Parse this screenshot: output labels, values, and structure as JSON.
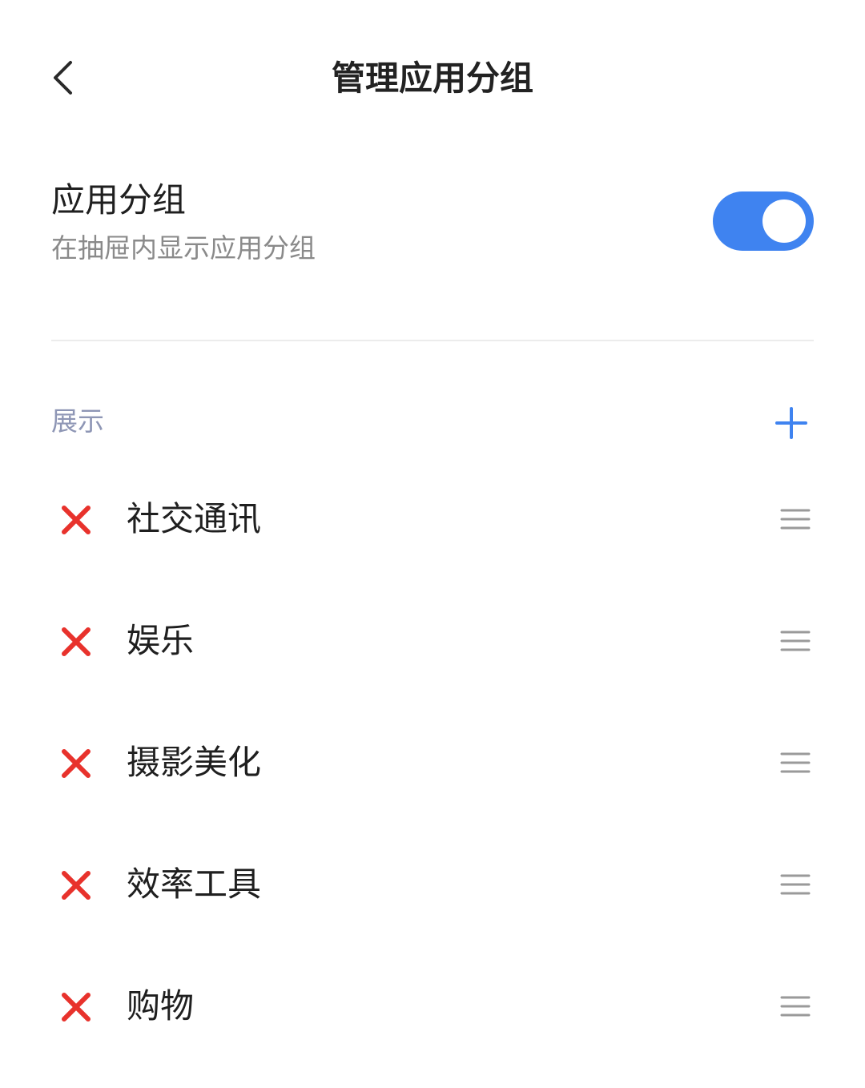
{
  "header": {
    "title": "管理应用分组",
    "back_icon": "chevron-left-icon"
  },
  "app_groups_setting": {
    "title": "应用分组",
    "subtitle": "在抽屉内显示应用分组",
    "enabled": true,
    "toggle_color": "#3f83f0"
  },
  "section": {
    "label": "展示",
    "add_icon": "plus-icon",
    "add_color": "#3f83f0"
  },
  "groups": [
    {
      "label": "社交通讯"
    },
    {
      "label": "娱乐"
    },
    {
      "label": "摄影美化"
    },
    {
      "label": "效率工具"
    },
    {
      "label": "购物"
    }
  ],
  "colors": {
    "remove": "#e8322c",
    "handle": "#9a9a9a",
    "section_label": "#8e96b5"
  }
}
